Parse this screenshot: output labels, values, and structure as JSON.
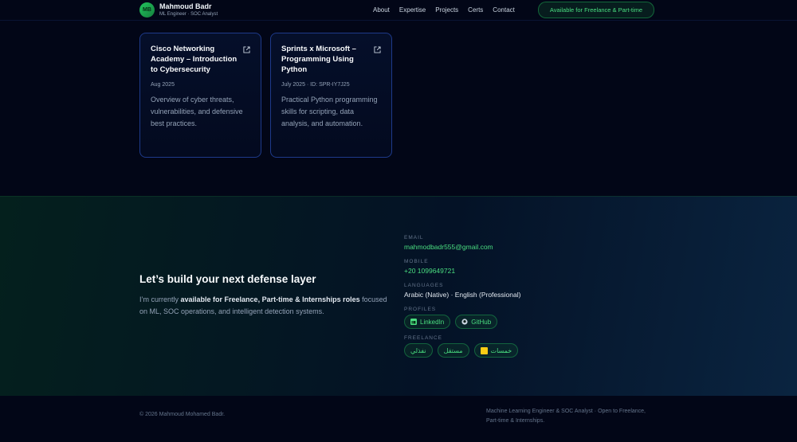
{
  "header": {
    "logo_initials": "MB",
    "name": "Mahmoud Badr",
    "subtitle": "ML Engineer · SOC Analyst",
    "nav": [
      "About",
      "Expertise",
      "Projects",
      "Certs",
      "Contact"
    ],
    "cta": "Available for Freelance & Part-time"
  },
  "certs": [
    {
      "title": "Cisco Networking Academy – Introduction to Cybersecurity",
      "date": "Aug 2025",
      "description": "Overview of cyber threats, vulnerabilities, and defensive best practices."
    },
    {
      "title": "Sprints x Microsoft – Programming Using Python",
      "date": "July 2025 · ID: SPR-IY7J25",
      "description": "Practical Python programming skills for scripting, data analysis, and automation."
    }
  ],
  "contact": {
    "title": "Let’s build your next defense layer",
    "desc_prefix": "I’m currently ",
    "desc_bold": "available for Freelance, Part-time & Internships roles",
    "desc_suffix": " focused on ML, SOC operations, and intelligent detection systems.",
    "email_label": "EMAIL",
    "email": "mahmodbadr555@gmail.com",
    "mobile_label": "MOBILE",
    "mobile": "+20 1099649721",
    "languages_label": "LANGUAGES",
    "languages": "Arabic (Native) · English (Professional)",
    "profiles_label": "PROFILES",
    "profiles": [
      "LinkedIn",
      "GitHub"
    ],
    "freelance_label": "FREELANCE",
    "freelance": [
      "نفذلي",
      "مستقل",
      "خمسات"
    ]
  },
  "footer": {
    "copyright": "© 2026 Mahmoud Mohamed Badr.",
    "tagline": "Machine Learning Engineer & SOC Analyst · Open to Freelance, Part-time & Internships."
  },
  "colors": {
    "accent": "#4ade80",
    "background": "#020617",
    "card_border": "#1e3a8a"
  },
  "icons": [
    "external-link-icon",
    "linkedin-icon",
    "github-icon",
    "khamsat-icon"
  ]
}
